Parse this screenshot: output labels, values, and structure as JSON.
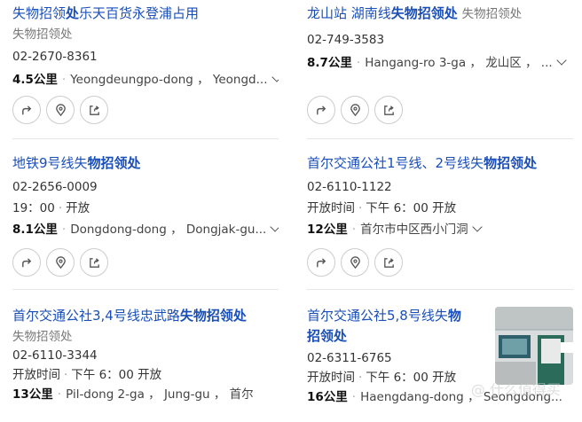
{
  "cards": [
    {
      "title_pre": "失物招领",
      "title_bold": "处",
      "title_post": "乐天百货永登浦占用",
      "category": "失物招领处",
      "phone": "02-2670-8361",
      "distance": "4.5公里",
      "address": "Yeongdeungpo-dong ， Yeongd..."
    },
    {
      "title_pre": "龙山站 湖南线",
      "title_bold": "失物招领处",
      "title_post": "",
      "category": "失物招领处",
      "phone": "02-749-3583",
      "distance": "8.7公里",
      "address": "Hangang-ro 3-ga ， 龙山区 ， ..."
    },
    {
      "title_pre": "地铁9号线失",
      "title_bold": "物招领处",
      "title_post": "",
      "phone": "02-2656-0009",
      "hours_time": "19：00",
      "hours_status": "开放",
      "distance": "8.1公里",
      "address": "Dongdong-dong ， Dongjak-gu..."
    },
    {
      "title_pre": "首尔交通公社1号线、2号线失",
      "title_bold": "物招领处",
      "title_post": "",
      "phone": "02-6110-1122",
      "hours_label": "开放时间",
      "hours_time": "下午 6：00",
      "hours_status": "开放",
      "distance": "12公里",
      "address": "首尔市中区西小门洞"
    },
    {
      "title_pre": "首尔交通公社3,4号线忠武路",
      "title_bold": "失物招领处",
      "title_post": "",
      "category": "失物招领处",
      "phone": "02-6110-3344",
      "hours_label": "开放时间",
      "hours_time": "下午 6：00",
      "hours_status": "开放",
      "distance": "13公里",
      "address": "Pil-dong 2-ga ， Jung-gu ， 首尔"
    },
    {
      "title_line1_pre": "首尔交通公社5,8号线失",
      "title_line1_bold": "物",
      "title_line2_bold": "招领处",
      "phone": "02-6311-6765",
      "hours_label": "开放时间",
      "hours_time": "下午 6：00",
      "hours_status": "开放",
      "distance": "16公里",
      "address": "Haengdang-dong ， Seongdong..."
    }
  ],
  "actions": [
    "directions-icon",
    "location-pin-icon",
    "share-icon"
  ],
  "watermark": "@ 什么值得买",
  "colors": {
    "title": "#1a4fb8",
    "divider": "#e6e6e6"
  }
}
